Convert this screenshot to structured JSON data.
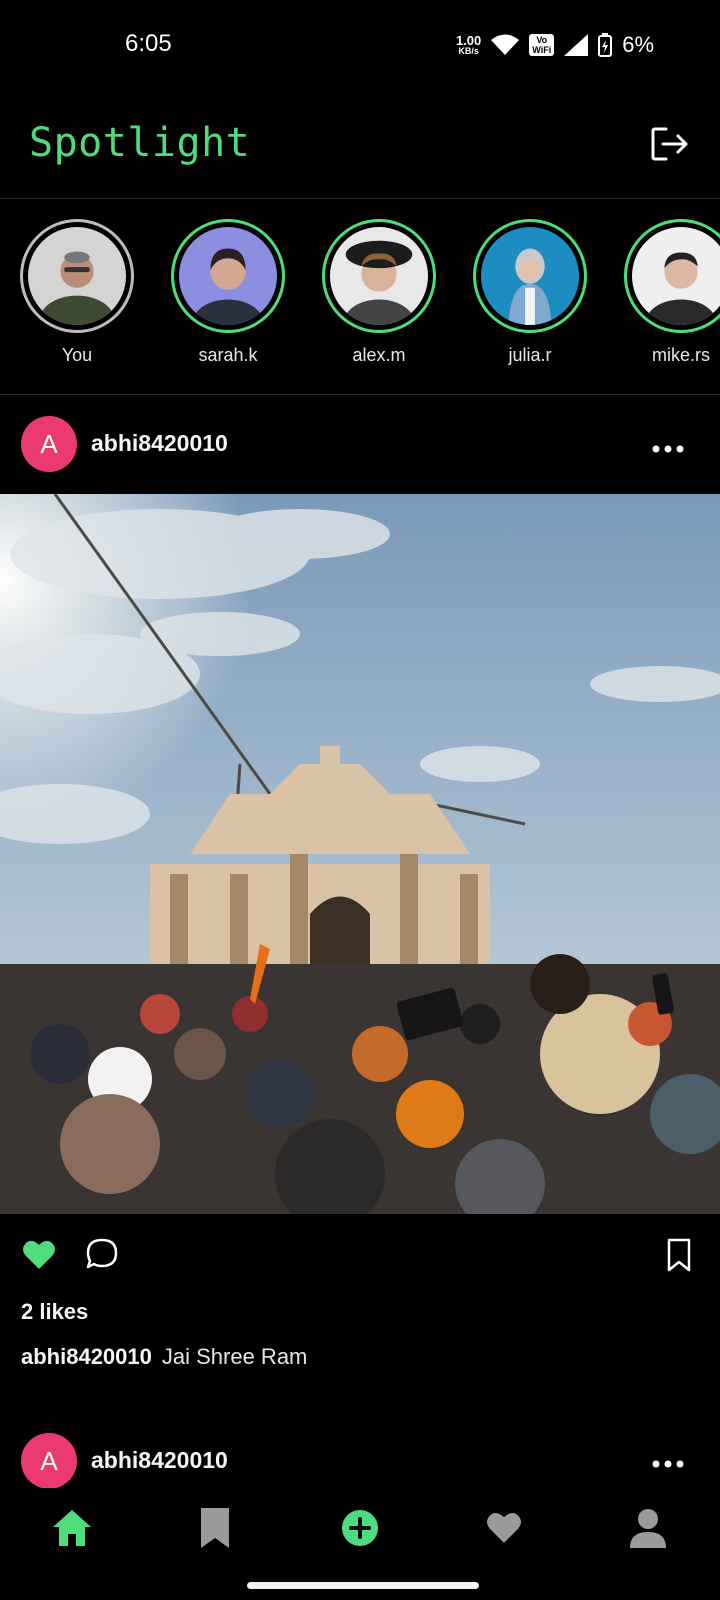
{
  "status_bar": {
    "time": "6:05",
    "net_speed_value": "1.00",
    "net_speed_unit": "KB/s",
    "vowifi_top": "Vo",
    "vowifi_bottom": "WiFi",
    "battery": "6%"
  },
  "header": {
    "title": "Spotlight",
    "logout_icon": "logout-icon",
    "accent_color": "#4fdc7c"
  },
  "stories": [
    {
      "name": "You",
      "own": true
    },
    {
      "name": "sarah.k"
    },
    {
      "name": "alex.m"
    },
    {
      "name": "julia.r"
    },
    {
      "name": "mike.rs"
    }
  ],
  "posts": [
    {
      "avatar_letter": "A",
      "avatar_color": "#ea3a6f",
      "username": "abhi8420010",
      "likes": "2 likes",
      "caption_user": "abhi8420010",
      "caption_text": "Jai Shree Ram",
      "liked": true
    },
    {
      "avatar_letter": "A",
      "username": "abhi8420010"
    }
  ],
  "bottom_nav": [
    {
      "icon": "home-icon",
      "active": true
    },
    {
      "icon": "bookmark-icon"
    },
    {
      "icon": "add-icon"
    },
    {
      "icon": "heart-icon"
    },
    {
      "icon": "profile-icon"
    }
  ]
}
